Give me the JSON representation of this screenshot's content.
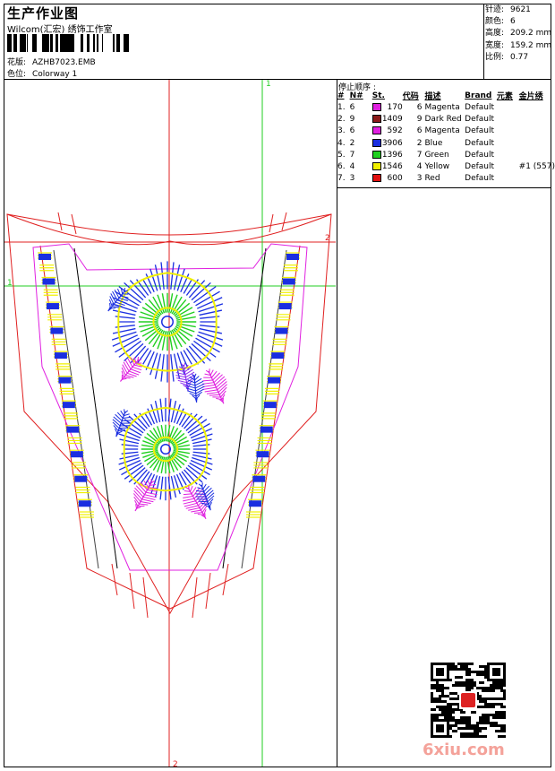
{
  "header": {
    "title": "生产作业图",
    "subtitle": "Wilcom(汇宏) 绣饰工作室",
    "design_label": "花版:",
    "design_value": "AZHB7023.EMB",
    "colorway_label": "色位:",
    "colorway_value": "Colorway 1"
  },
  "stats": [
    {
      "label": "针迹:",
      "value": "9621"
    },
    {
      "label": "颜色:",
      "value": "6"
    },
    {
      "label": "高度:",
      "value": "209.2 mm"
    },
    {
      "label": "宽度:",
      "value": "159.2 mm"
    },
    {
      "label": "比例:",
      "value": "0.77"
    }
  ],
  "stop_sequence": {
    "title": "停止顺序 :",
    "headers": [
      "#",
      "N#",
      "St.",
      "代码",
      "描述",
      "Brand",
      "元素",
      "金片绣"
    ],
    "rows": [
      {
        "idx": "1.",
        "n": "6",
        "color": "#e020e0",
        "st": "170",
        "code": "6",
        "desc": "Magenta",
        "brand": "Default",
        "elem": "",
        "seq": ""
      },
      {
        "idx": "2.",
        "n": "9",
        "color": "#8b1a1a",
        "st": "1409",
        "code": "9",
        "desc": "Dark Red",
        "brand": "Default",
        "elem": "",
        "seq": ""
      },
      {
        "idx": "3.",
        "n": "6",
        "color": "#e020e0",
        "st": "592",
        "code": "6",
        "desc": "Magenta",
        "brand": "Default",
        "elem": "",
        "seq": ""
      },
      {
        "idx": "4.",
        "n": "2",
        "color": "#1a2ee0",
        "st": "3906",
        "code": "2",
        "desc": "Blue",
        "brand": "Default",
        "elem": "",
        "seq": ""
      },
      {
        "idx": "5.",
        "n": "7",
        "color": "#20d020",
        "st": "1396",
        "code": "7",
        "desc": "Green",
        "brand": "Default",
        "elem": "",
        "seq": ""
      },
      {
        "idx": "6.",
        "n": "4",
        "color": "#f0f000",
        "st": "1546",
        "code": "4",
        "desc": "Yellow",
        "brand": "Default",
        "elem": "",
        "seq": "#1 (557)"
      },
      {
        "idx": "7.",
        "n": "3",
        "color": "#e01010",
        "st": "600",
        "code": "3",
        "desc": "Red",
        "brand": "Default",
        "elem": "",
        "seq": ""
      }
    ]
  },
  "guides": {
    "h1": "1",
    "h2": "2",
    "v1": "1",
    "v2": "2"
  },
  "watermark": {
    "text": "6xiu.com"
  },
  "colors": {
    "outline": "#e02020",
    "guide_green": "#22cc22",
    "blue": "#1a2ee0",
    "green": "#20d020",
    "yellow": "#f0f000",
    "magenta": "#e020e0",
    "purple": "#9030f0"
  },
  "icons": {
    "barcode": "barcode-icon",
    "qr": "qr-code-icon"
  }
}
